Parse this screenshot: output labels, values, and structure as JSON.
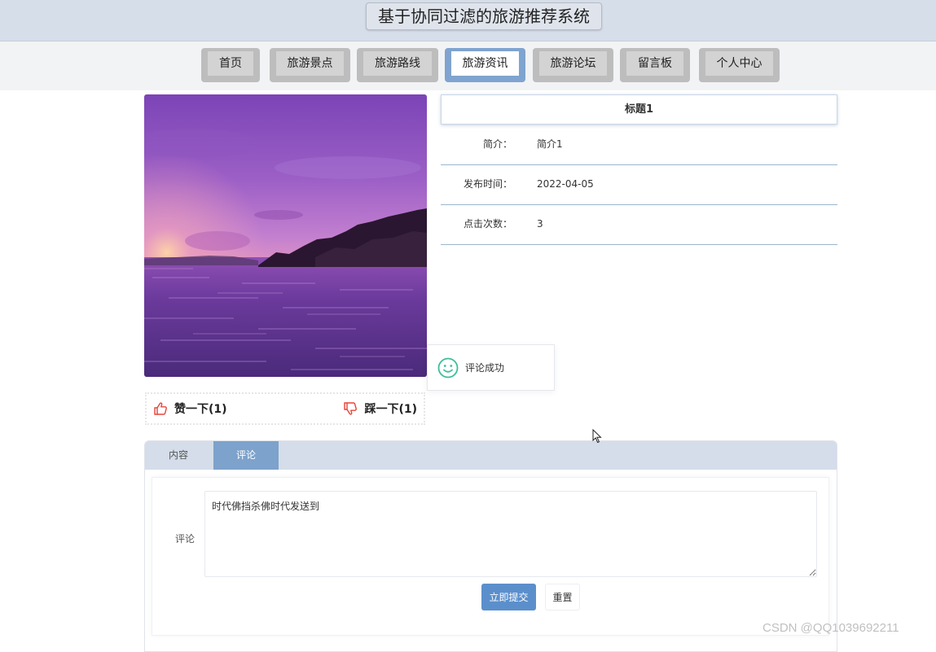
{
  "header": {
    "site_title": "基于协同过滤的旅游推荐系统"
  },
  "nav": {
    "items": [
      {
        "label": "首页",
        "active": false
      },
      {
        "label": "旅游景点",
        "active": false
      },
      {
        "label": "旅游路线",
        "active": false
      },
      {
        "label": "旅游资讯",
        "active": true
      },
      {
        "label": "旅游论坛",
        "active": false
      },
      {
        "label": "留言板",
        "active": false
      },
      {
        "label": "个人中心",
        "active": false
      }
    ]
  },
  "article": {
    "title": "标题1",
    "fields": [
      {
        "label": "简介：",
        "value": "简介1"
      },
      {
        "label": "发布时间：",
        "value": "2022-04-05"
      },
      {
        "label": "点击次数：",
        "value": "3"
      }
    ]
  },
  "toast": {
    "message": "评论成功",
    "icon": "smile-icon"
  },
  "votes": {
    "like_label": "赞一下(1)",
    "like_icon": "thumbs-up-icon",
    "dislike_label": "踩一下(1)",
    "dislike_icon": "thumbs-down-icon"
  },
  "tabs": [
    {
      "label": "内容",
      "active": false
    },
    {
      "label": "评论",
      "active": true
    }
  ],
  "comment_form": {
    "label": "评论",
    "value": "时代佛挡杀佛时代发送到",
    "submit_label": "立即提交",
    "reset_label": "重置"
  },
  "watermark": "CSDN @QQ1039692211",
  "colors": {
    "header_bg": "#d6dee9",
    "active_tab": "#7da2cb",
    "submit_button": "#5b8fcc",
    "toast_icon": "#3cbf9a",
    "vote_icon": "#e8443a"
  }
}
